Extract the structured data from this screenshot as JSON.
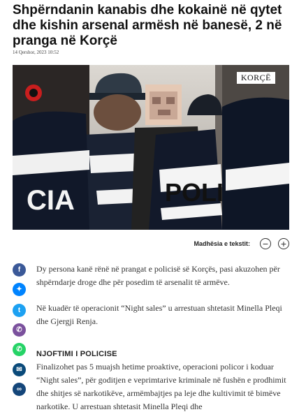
{
  "article": {
    "headline": "Shpërndanin kanabis dhe kokainë në qytet dhe kishin arsenal armësh në banesë, 2 në pranga në Korçë",
    "date": "14 Qershor, 2023 10:52",
    "image_tag": "KORÇË",
    "badge_text": "POLICIA",
    "paragraphs": [
      "Dy persona kanë rënë në prangat e policisë së Korçës, pasi akuzohen për shpërndarje droge dhe për posedim të arsenalit të armëve.",
      "Në kuadër të operacionit “Night sales” u arrestuan shtetasit Minella Pleqi dhe Gjergji Renja.",
      "Finalizohet pas 5 muajsh hetime proaktive, operacioni policor i koduar “Night sales”, për goditjen e veprimtarive kriminale në fushën e prodhimit dhe shitjes së narkotikëve, armëmbajtjes pa leje dhe kultivimit të bimëve narkotike. U arrestuan shtetasit Minella Pleqi dhe"
    ],
    "subheading": "NJOFTIMI I POLICISE"
  },
  "controls": {
    "font_size_label": "Madhësia e tekstit:",
    "decrease_symbol": "−",
    "increase_symbol": "+"
  },
  "share": [
    {
      "name": "facebook-icon",
      "glyph": "f",
      "color": "#3b5998"
    },
    {
      "name": "messenger-icon",
      "glyph": "✦",
      "color": "#0084ff"
    },
    {
      "name": "twitter-icon",
      "glyph": "t",
      "color": "#1da1f2"
    },
    {
      "name": "viber-icon",
      "glyph": "✆",
      "color": "#7b519d"
    },
    {
      "name": "whatsapp-icon",
      "glyph": "✆",
      "color": "#25d366"
    },
    {
      "name": "email-icon",
      "glyph": "✉",
      "color": "#0a4a7a"
    },
    {
      "name": "link-icon",
      "glyph": "∞",
      "color": "#14467a"
    }
  ],
  "text_words": [
    "CIA",
    "POLI"
  ]
}
